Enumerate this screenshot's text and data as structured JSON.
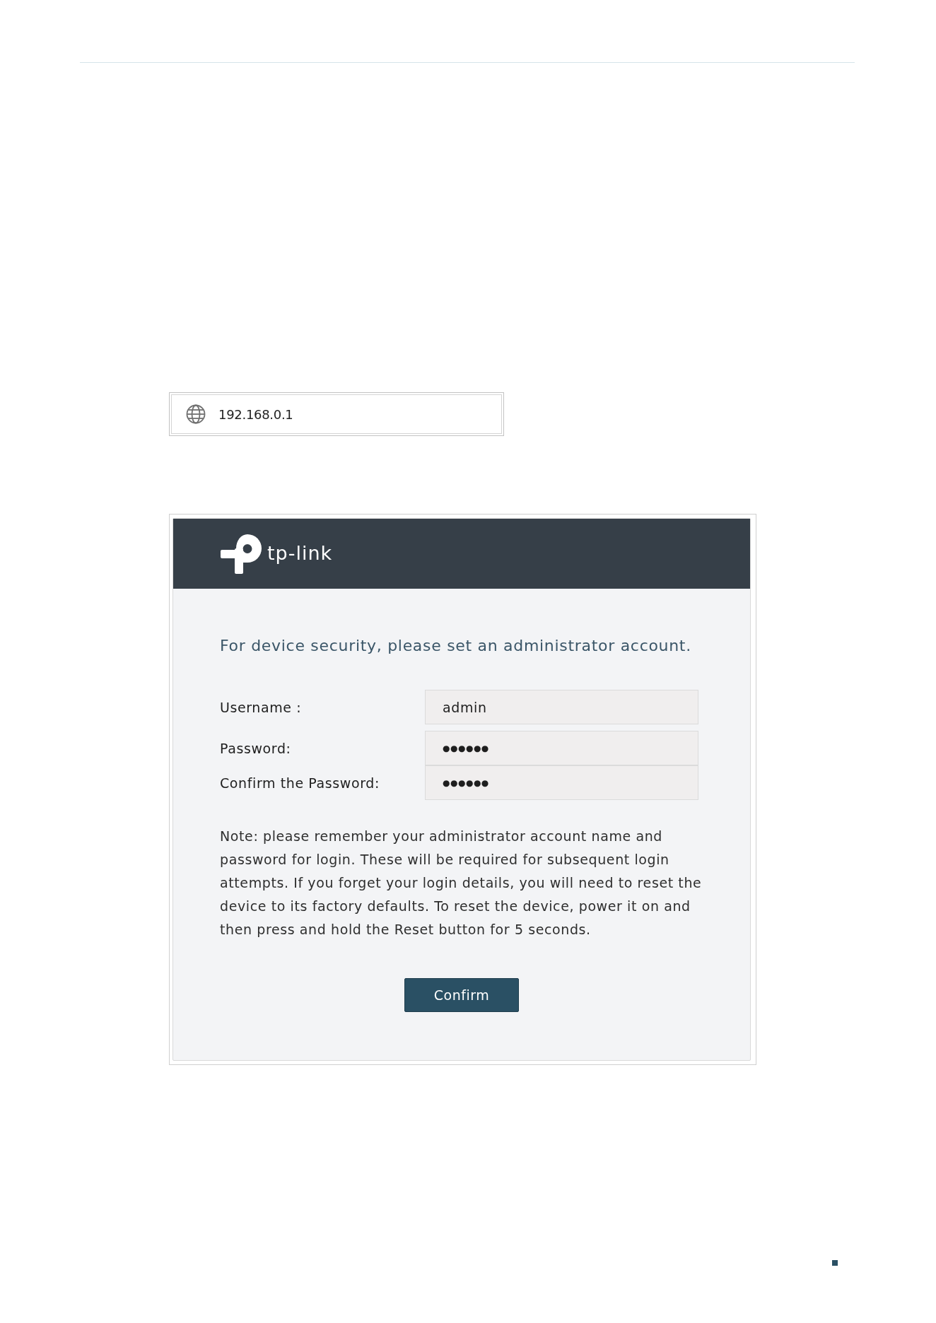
{
  "address_bar": {
    "url": "192.168.0.1"
  },
  "login_panel": {
    "logo_text": "tp-link",
    "heading": "For device security, please set an administrator account.",
    "fields": [
      {
        "kind": "text",
        "label": "Username :",
        "value": "admin"
      },
      {
        "kind": "password",
        "label": "Password:",
        "value": "●●●●●●"
      },
      {
        "kind": "password",
        "label": "Confirm the Password:",
        "value": "●●●●●●"
      }
    ],
    "note": "Note: please remember your administrator account name and password for login. These will be required for subsequent login attempts. If you forget your login details, you will need to reset the device to its factory defaults. To reset the device, power it on and then press and hold the Reset button for 5 seconds.",
    "buttons": [
      {
        "label": "Confirm"
      }
    ]
  }
}
